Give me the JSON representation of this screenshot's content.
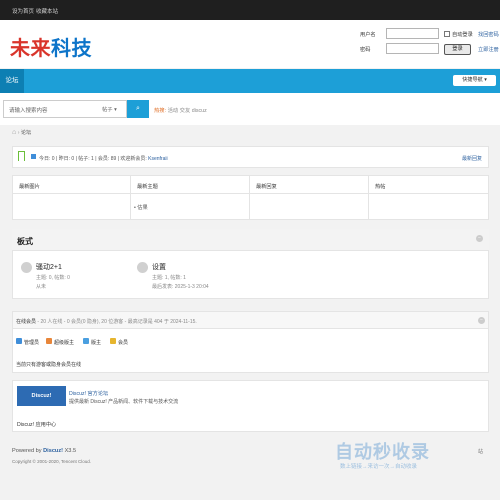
{
  "topbar": {
    "set_home": "设为首页",
    "bookmark": "收藏本站"
  },
  "header": {
    "logo_part1": "未来",
    "logo_part2": "科技",
    "login": {
      "username_label": "用户名",
      "password_label": "密码",
      "auto_login": "自动登录",
      "forgot_password": "找回密码",
      "login_button": "登录",
      "register": "立即注册"
    }
  },
  "nav": {
    "active_tab": "论坛",
    "quick_nav": "快捷导航"
  },
  "search": {
    "placeholder": "请输入搜索内容",
    "type": "帖子",
    "hot_label": "热搜:",
    "hot_words": [
      "活动",
      "交友",
      "discuz"
    ]
  },
  "breadcrumb": {
    "home_icon": "home-icon",
    "current": "论坛"
  },
  "stats": {
    "today": "今日: 0",
    "yesterday": "昨日: 0",
    "posts": "帖子: 1",
    "members": "会员: 89",
    "welcome": "欢迎新会员:",
    "new_member": "Ksenfraii",
    "latest_reply": "最新回复"
  },
  "grid": {
    "headers": [
      "最新图片",
      "最新主题",
      "最新回复",
      "热帖"
    ],
    "topic_item": "• 估果"
  },
  "forum_section": {
    "title": "板式",
    "forums": [
      {
        "name": "骚动2+1",
        "sub1": "主题: 0, 帖数: 0",
        "sub2": "从未"
      },
      {
        "name": "设置",
        "sub1": "主题: 1, 帖数: 1",
        "sub2": "最后发表: 2025-1-3 20:04"
      }
    ]
  },
  "online": {
    "title": "在线会员",
    "detail": "- 20 人在线 - 0 会员(0 隐身), 20 位游客 - 最高记录是 404 于 2024-11-15.",
    "legend": [
      {
        "label": "管理员",
        "color": "#3f8ed9"
      },
      {
        "label": "超级版主",
        "color": "#e8863a"
      },
      {
        "label": "版主",
        "color": "#4a9fe0"
      },
      {
        "label": "会员",
        "color": "#e6b52e"
      }
    ],
    "note": "当前只有游客或隐身会员在线"
  },
  "links": {
    "image_text": "Discuz!",
    "name": "Discuz! 官方论坛",
    "desc": "提供最新 Discuz! 产品新闻、软件下载与技术交流",
    "app_center": "Discuz! 应用中心"
  },
  "footer": {
    "powered": "Powered by",
    "product": "Discuz!",
    "version": "X3.5",
    "copyright": "Copyright © 2001-2020, Tencent Cloud.",
    "watermark": "自动秒收录",
    "watermark_sub": "数上链接→来访一次→自动收录",
    "right_link": "站"
  }
}
